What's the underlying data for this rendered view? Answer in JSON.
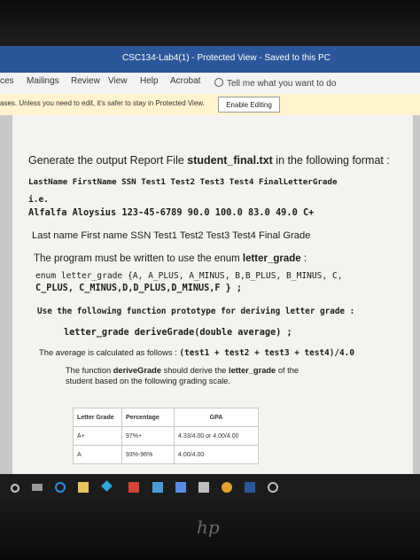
{
  "window": {
    "title": "CSC134-Lab4(1) - Protected View - Saved to this PC"
  },
  "ribbon": {
    "tabs": [
      "ces",
      "Mailings",
      "Review",
      "View",
      "Help",
      "Acrobat"
    ],
    "tell_me": "Tell me what you want to do"
  },
  "protected_view": {
    "message": "ases. Unless you need to edit, it's safer to stay in Protected View.",
    "enable_button": "Enable Editing"
  },
  "document": {
    "intro": "Generate the output Report File ",
    "filename": "student_final.txt",
    "intro_tail": " in the following format :",
    "header_line": "LastName FirstName  SSN Test1  Test2  Test3  Test4 FinalLetterGrade",
    "ie": "i.e.",
    "example_line": "Alfalfa  Aloysius  123-45-6789 90.0  100.0   83.0   49.0  C+",
    "plain_header": "Last name First name SSN          Test1 Test2 Test3 Test4 Final Grade",
    "enum_intro": "The program must be written to use the enum ",
    "enum_name": "letter_grade",
    "enum_intro_tail": " :",
    "enum_line1": "enum letter_grade {A, A_PLUS, A_MINUS, B,B_PLUS, B_MINUS, C,",
    "enum_line2": "C_PLUS, C_MINUS,D,D_PLUS,D_MINUS,F } ;",
    "prototype_heading": "Use the following function prototype for deriving letter grade :",
    "prototype": "letter_grade deriveGrade(double average) ;",
    "average_text": "The average is calculated as follows : ",
    "average_formula": "(test1 + test2 + test3 + test4)/4.0",
    "derive_line1_a": "The function ",
    "derive_fn": "deriveGrade",
    "derive_line1_b": " should derive the ",
    "derive_lg": "letter_grade",
    "derive_line1_c": " of the",
    "derive_line2": "student based on the following grading scale.",
    "table": {
      "headers": [
        "Letter Grade",
        "Percentage",
        "GPA"
      ],
      "rows": [
        [
          "A+",
          "97%+",
          "4.33/4.00 or 4.00/4.00"
        ],
        [
          "A",
          "93%-96%",
          "4.00/4.00"
        ]
      ]
    }
  },
  "laptop": {
    "brand": "hp"
  },
  "colors": {
    "titlebar": "#2b579a",
    "message_bar": "#fff4ce",
    "page": "#f4f3f0"
  }
}
